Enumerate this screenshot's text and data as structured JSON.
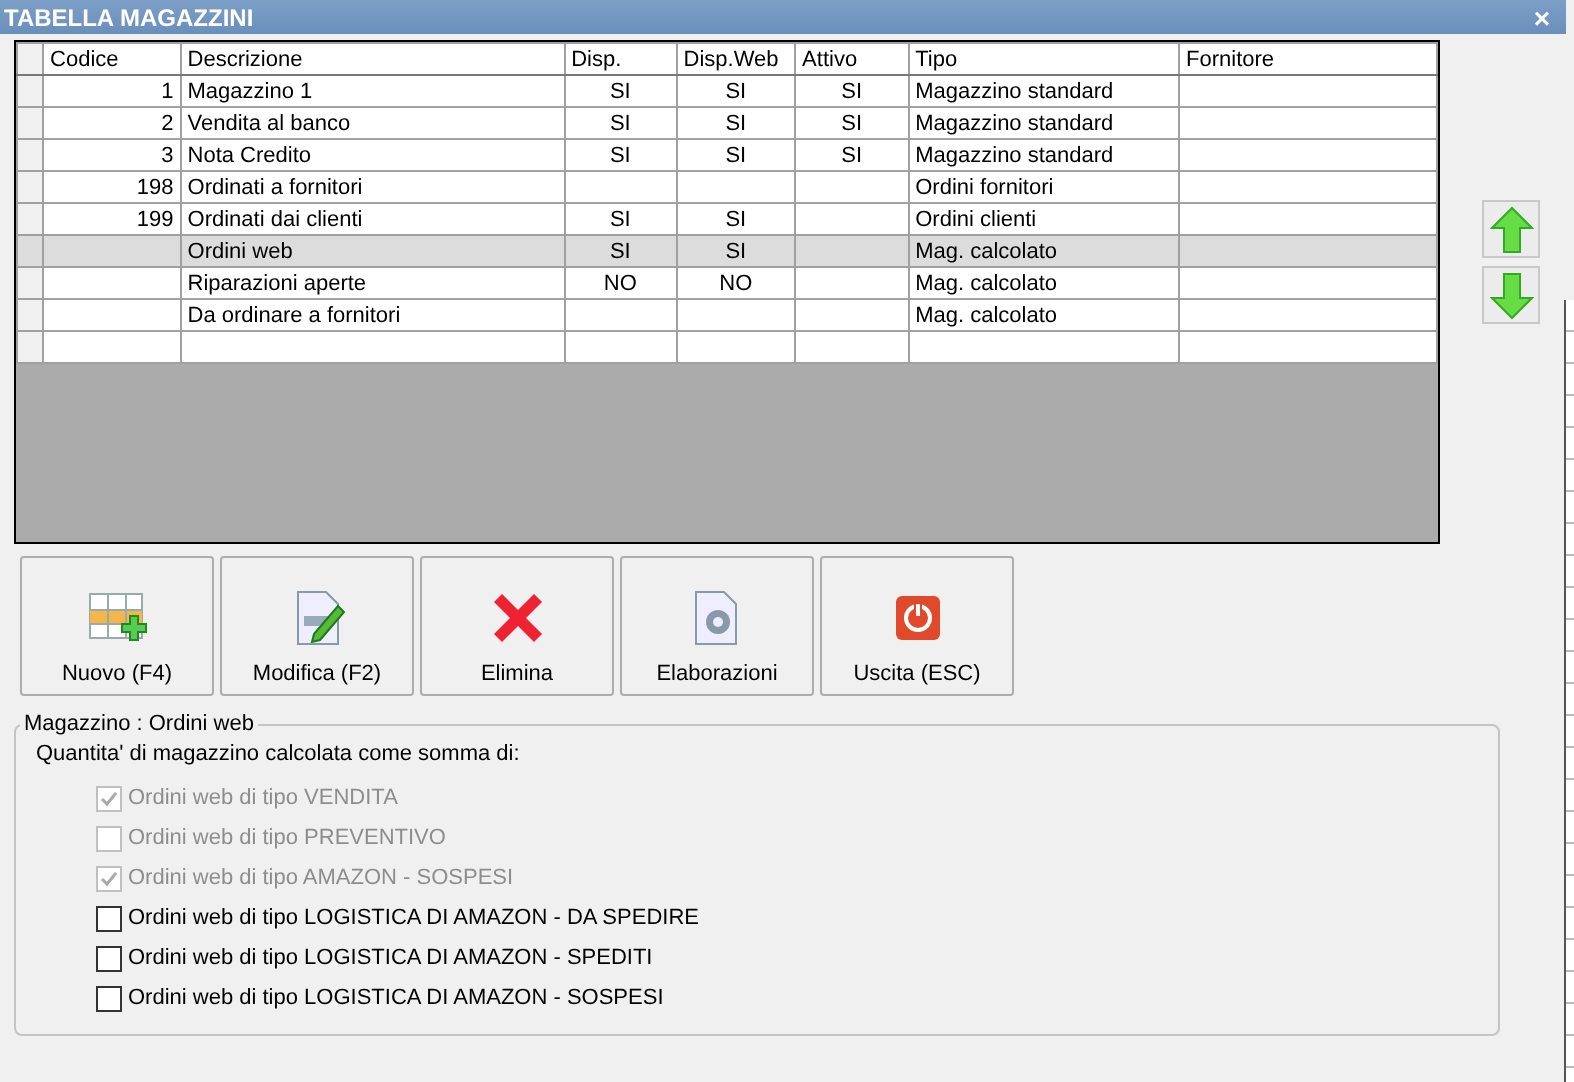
{
  "window": {
    "title": "TABELLA MAGAZZINI",
    "close": "×"
  },
  "table": {
    "columns": [
      "Codice",
      "Descrizione",
      "Disp.",
      "Disp.Web",
      "Attivo",
      "Tipo",
      "Fornitore"
    ],
    "rows": [
      {
        "codice": "1",
        "descrizione": "Magazzino 1",
        "disp": "SI",
        "disp_web": "SI",
        "attivo": "SI",
        "tipo": "Magazzino standard",
        "selected": false
      },
      {
        "codice": "2",
        "descrizione": "Vendita al banco",
        "disp": "SI",
        "disp_web": "SI",
        "attivo": "SI",
        "tipo": "Magazzino standard",
        "selected": false
      },
      {
        "codice": "3",
        "descrizione": "Nota Credito",
        "disp": "SI",
        "disp_web": "SI",
        "attivo": "SI",
        "tipo": "Magazzino standard",
        "selected": false
      },
      {
        "codice": "198",
        "descrizione": "Ordinati a fornitori",
        "tipo": "Ordini fornitori",
        "selected": false
      },
      {
        "codice": "199",
        "descrizione": "Ordinati dai clienti",
        "disp": "SI",
        "disp_web": "SI",
        "tipo": "Ordini clienti",
        "selected": false
      },
      {
        "descrizione": "Ordini web",
        "disp": "SI",
        "disp_web": "SI",
        "tipo": "Mag. calcolato",
        "selected": true
      },
      {
        "descrizione": "Riparazioni aperte",
        "disp": "NO",
        "disp_web": "NO",
        "tipo": "Mag. calcolato",
        "selected": false
      },
      {
        "descrizione": "Da ordinare a fornitori",
        "tipo": "Mag. calcolato",
        "selected": false
      }
    ]
  },
  "buttons": [
    {
      "label": "Nuovo (F4)",
      "kind": "new"
    },
    {
      "label": "Modifica (F2)",
      "kind": "edit"
    },
    {
      "label": "Elimina",
      "kind": "delete"
    },
    {
      "label": "Elaborazioni",
      "kind": "process"
    },
    {
      "label": "Uscita (ESC)",
      "kind": "exit"
    }
  ],
  "group": {
    "legend": "Magazzino : Ordini web",
    "caption": "Quantita' di magazzino calcolata come somma di:",
    "options": [
      {
        "label": "Ordini web di tipo VENDITA",
        "checked": true,
        "disabled": true
      },
      {
        "label": "Ordini web di tipo PREVENTIVO",
        "checked": false,
        "disabled": true
      },
      {
        "label": "Ordini web di tipo AMAZON - SOSPESI",
        "checked": true,
        "disabled": true
      },
      {
        "label": "Ordini web di tipo LOGISTICA DI AMAZON - DA SPEDIRE",
        "checked": false,
        "disabled": false
      },
      {
        "label": "Ordini web di tipo LOGISTICA DI AMAZON - SPEDITI",
        "checked": false,
        "disabled": false
      },
      {
        "label": "Ordini web di tipo LOGISTICA DI AMAZON - SOSPESI",
        "checked": false,
        "disabled": false
      }
    ]
  }
}
